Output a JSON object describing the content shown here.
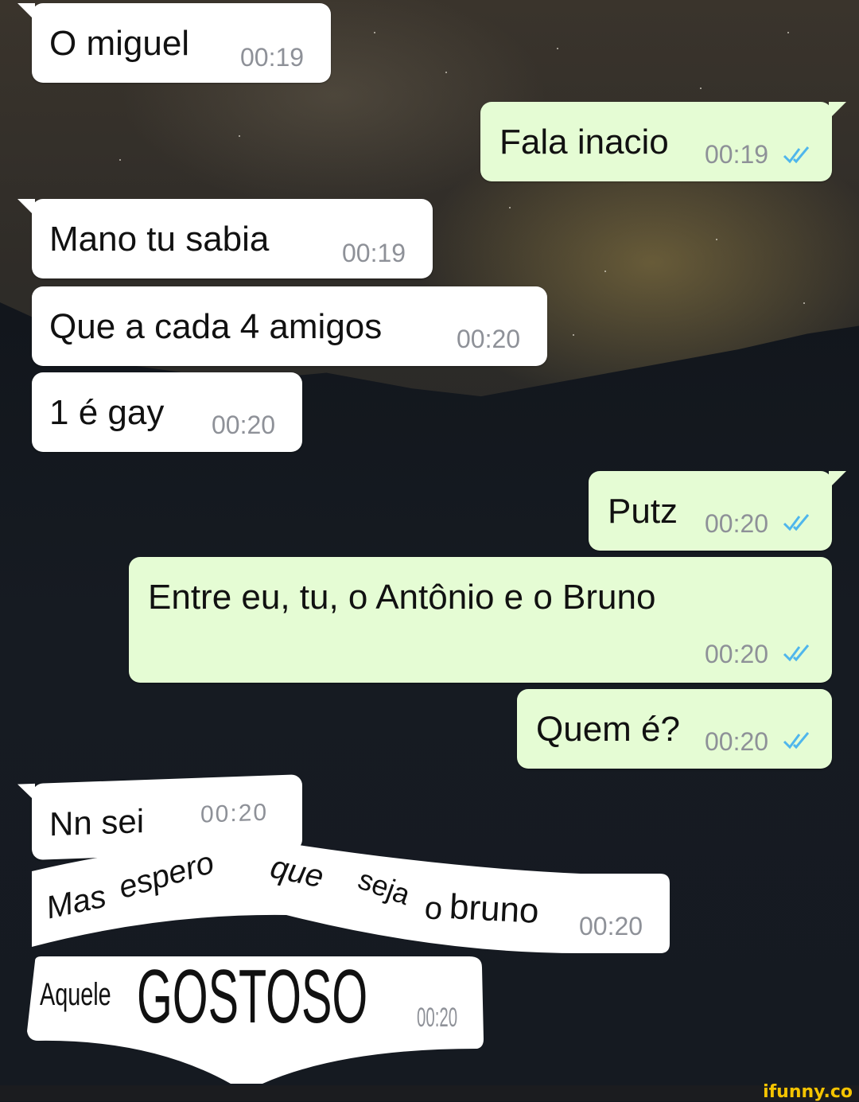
{
  "messages": [
    {
      "text": "O miguel",
      "time": "00:19"
    },
    {
      "text": "Fala inacio",
      "time": "00:19"
    },
    {
      "text": "Mano tu sabia",
      "time": "00:19"
    },
    {
      "text": "Que a cada 4 amigos",
      "time": "00:20"
    },
    {
      "text": "1 é gay",
      "time": "00:20"
    },
    {
      "text": "Putz",
      "time": "00:20"
    },
    {
      "text": "Entre eu, tu, o Antônio e o Bruno",
      "time": "00:20"
    },
    {
      "text": "Quem é?",
      "time": "00:20"
    },
    {
      "text": "Nn sei",
      "time": "00:20"
    },
    {
      "text_parts": [
        "Mas",
        "espero",
        "que",
        "seja",
        "o",
        "bruno"
      ],
      "time": "00:20"
    },
    {
      "text_parts": [
        "Aquele",
        "GOSTOSO"
      ],
      "time": "00:20"
    }
  ],
  "colors": {
    "incoming": "#ffffff",
    "outgoing": "#e5fcd4",
    "read_ticks": "#4fb6ec",
    "timestamp": "#8e9198"
  },
  "icons": {
    "read_receipt": "double-check-icon"
  },
  "watermark": "ifunny.co"
}
